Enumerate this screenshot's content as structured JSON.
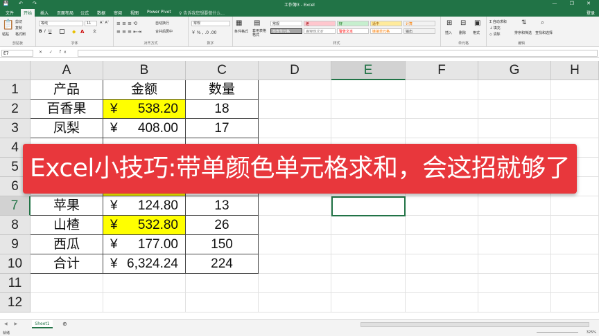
{
  "window": {
    "title": "工作簿3 - Excel",
    "login": "登录"
  },
  "ribbon_tabs": [
    "文件",
    "开始",
    "插入",
    "页面布局",
    "公式",
    "数据",
    "审阅",
    "视图",
    "Power Pivot",
    "♀ 告诉我您想要做什么..."
  ],
  "ribbon": {
    "clipboard": {
      "paste": "粘贴",
      "cut": "剪切",
      "copy": "复制",
      "format_painter": "格式刷",
      "label": "剪贴板"
    },
    "font": {
      "name": "等线",
      "size": "11",
      "label": "字体"
    },
    "alignment": {
      "wrap": "自动换行",
      "merge": "合并后居中",
      "label": "对齐方式"
    },
    "number": {
      "format": "常规",
      "label": "数字"
    },
    "styles": {
      "conditional": "条件格式",
      "table": "套用表格格式",
      "normal": "常规",
      "bad": "差",
      "good": "好",
      "neutral": "适中",
      "calc": "计算",
      "check": "检查单元格",
      "explanatory": "解释性文本",
      "warning": "警告文本",
      "linked": "链接单元格",
      "output": "输出",
      "label": "样式"
    },
    "cells": {
      "insert": "插入",
      "delete": "删除",
      "format": "格式",
      "label": "单元格"
    },
    "editing": {
      "autosum": "自动求和",
      "fill": "填充",
      "clear": "清除",
      "sort": "排序和筛选",
      "find": "查找和选择",
      "label": "编辑"
    }
  },
  "formula_bar": {
    "namebox": "E7",
    "fx": "✕ ✓ fx"
  },
  "columns": [
    "A",
    "B",
    "C",
    "D",
    "E",
    "F",
    "G",
    "H"
  ],
  "rows": [
    "1",
    "2",
    "3",
    "4",
    "5",
    "6",
    "7",
    "8",
    "9",
    "10",
    "11",
    "12"
  ],
  "table": {
    "header": [
      "产品",
      "金额",
      "数量"
    ],
    "data": [
      {
        "product": "百香果",
        "currency": "¥",
        "amount": "538.20",
        "qty": "18",
        "highlight": true
      },
      {
        "product": "凤梨",
        "currency": "¥",
        "amount": "408.00",
        "qty": "17",
        "highlight": false
      },
      {
        "product": "",
        "currency": "",
        "amount": "",
        "qty": "",
        "highlight": false
      },
      {
        "product": "",
        "currency": "",
        "amount": "",
        "qty": "",
        "highlight": false
      },
      {
        "product": "",
        "currency": "",
        "amount": "",
        "qty": "",
        "highlight": true
      },
      {
        "product": "苹果",
        "currency": "¥",
        "amount": "124.80",
        "qty": "13",
        "highlight": false
      },
      {
        "product": "山楂",
        "currency": "¥",
        "amount": "532.80",
        "qty": "26",
        "highlight": true
      },
      {
        "product": "西瓜",
        "currency": "¥",
        "amount": "177.00",
        "qty": "150",
        "highlight": false
      },
      {
        "product": "合计",
        "currency": "¥",
        "amount": "6,324.24",
        "qty": "224",
        "highlight": false
      }
    ]
  },
  "selected_cell": "E7",
  "banner": {
    "text": "Excel小技巧:带单颜色单元格求和，会这招就够了",
    "color": "#e8373c"
  },
  "sheets": [
    "Sheet1"
  ],
  "status": {
    "ready": "就绪",
    "zoom": "325%"
  },
  "colors": {
    "accent": "#217346",
    "highlight": "#ffff00"
  }
}
